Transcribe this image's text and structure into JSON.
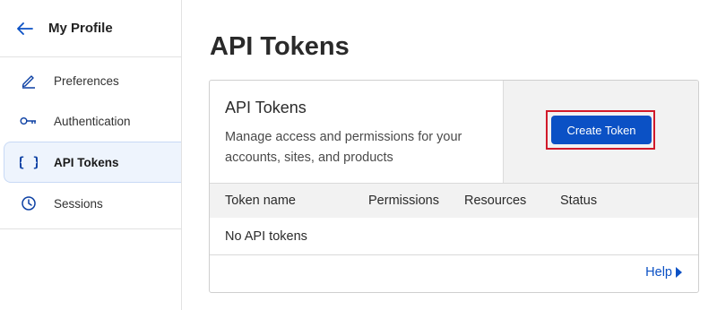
{
  "sidebar": {
    "title": "My Profile",
    "items": [
      {
        "label": "Preferences",
        "icon": "pencil-icon"
      },
      {
        "label": "Authentication",
        "icon": "key-icon"
      },
      {
        "label": "API Tokens",
        "icon": "braces-icon",
        "active": true
      },
      {
        "label": "Sessions",
        "icon": "clock-icon"
      }
    ]
  },
  "main": {
    "title": "API Tokens",
    "card": {
      "heading": "API Tokens",
      "description": "Manage access and permissions for your accounts, sites, and products",
      "create_button": "Create Token",
      "columns": [
        "Token name",
        "Permissions",
        "Resources",
        "Status"
      ],
      "empty_message": "No API tokens",
      "help_link": "Help"
    }
  },
  "colors": {
    "accent": "#0b51c5",
    "highlight": "#d11a2a",
    "active_bg": "#eef4fd"
  }
}
